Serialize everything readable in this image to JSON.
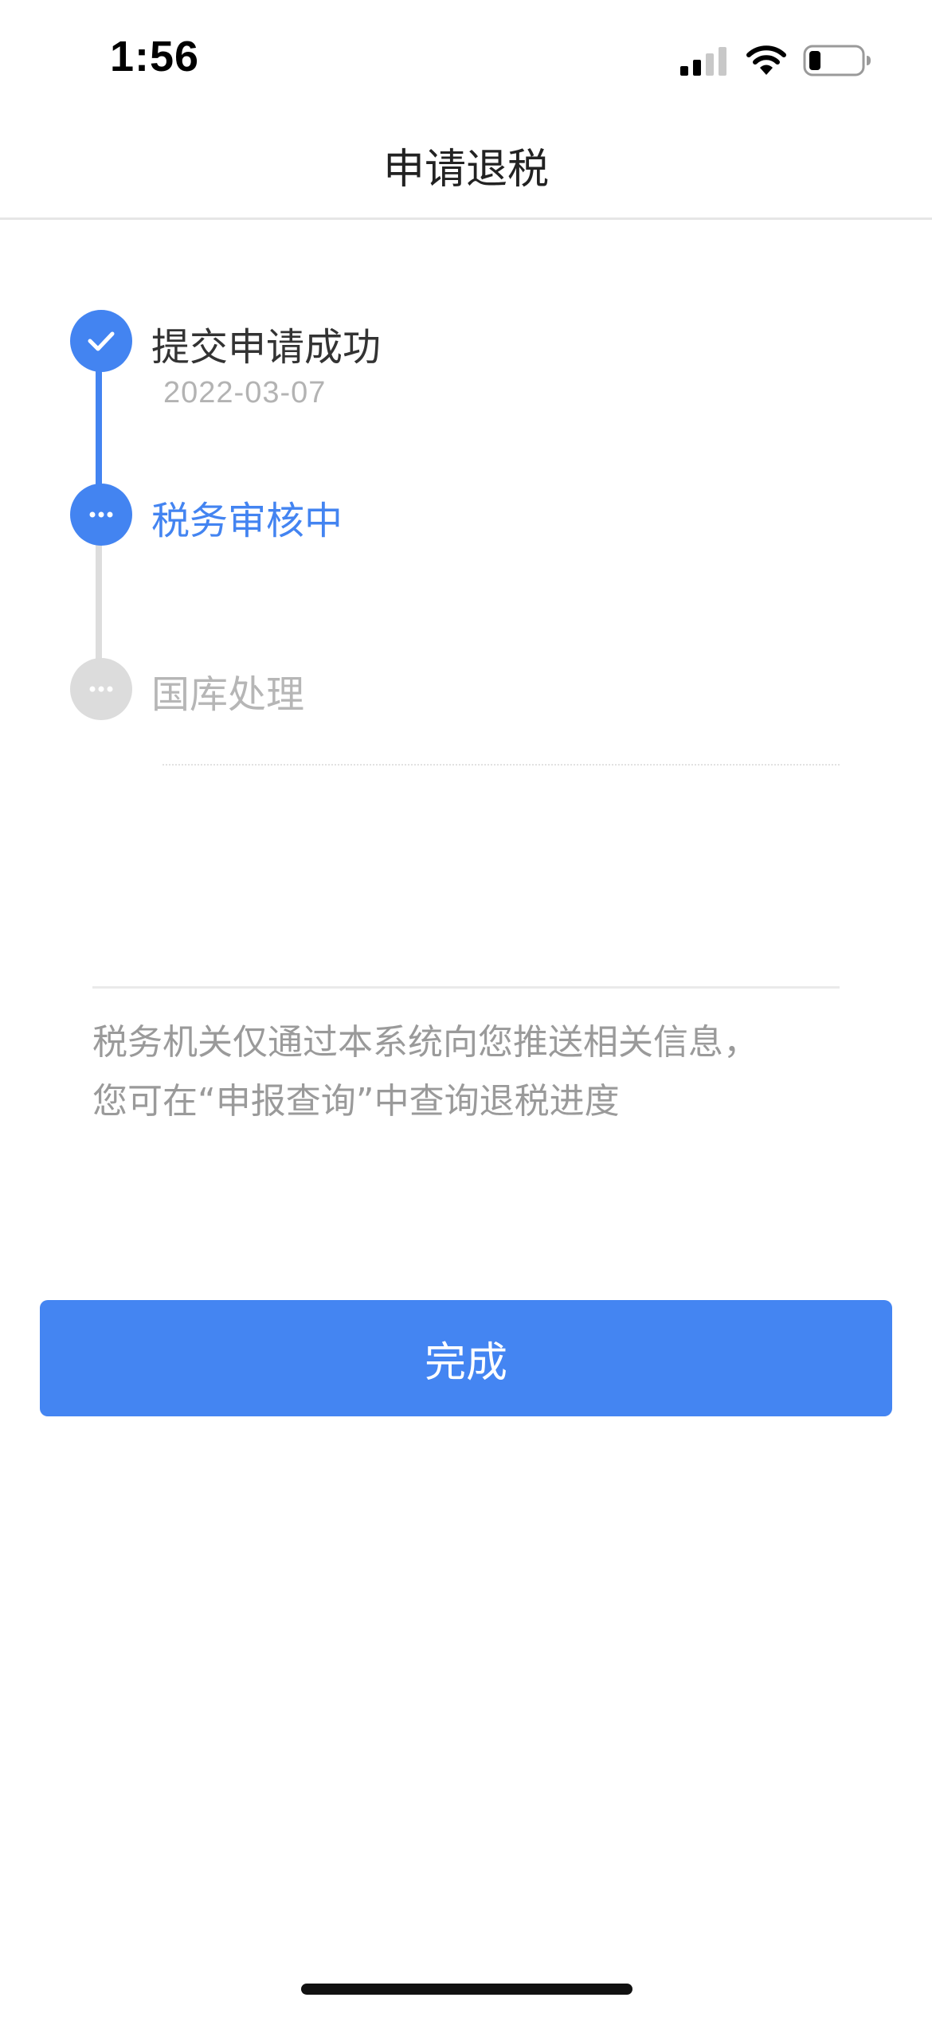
{
  "status_bar": {
    "time": "1:56",
    "icons": [
      "cellular-signal-icon",
      "wifi-icon",
      "battery-icon"
    ]
  },
  "nav": {
    "title": "申请退税"
  },
  "timeline": {
    "steps": [
      {
        "label": "提交申请成功",
        "date": "2022-03-07",
        "state": "done",
        "icon": "checkmark-icon"
      },
      {
        "label": "税务审核中",
        "state": "current",
        "icon": "ellipsis-icon"
      },
      {
        "label": "国库处理",
        "state": "pending",
        "icon": "ellipsis-icon"
      }
    ]
  },
  "notice": {
    "line1": "税务机关仅通过本系统向您推送相关信息，",
    "line2": "您可在“申报查询”中查询退税进度"
  },
  "actions": {
    "done_label": "完成"
  },
  "colors": {
    "accent": "#4384f1",
    "pending": "#dcdcdc",
    "muted_text": "#9a9a9a"
  }
}
